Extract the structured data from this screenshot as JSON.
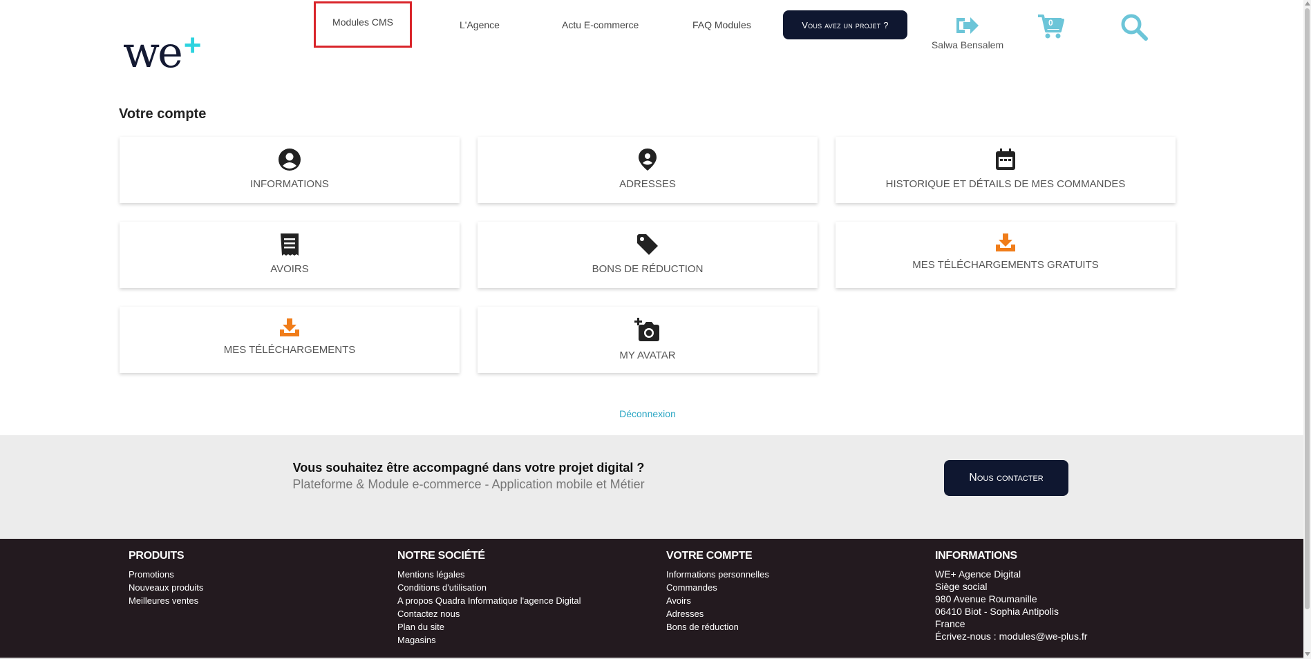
{
  "header": {
    "logo_text": "we",
    "logo_plus": "+",
    "nav": [
      {
        "label": "Modules CMS"
      },
      {
        "label": "L'Agence"
      },
      {
        "label": "Actu E-commerce"
      },
      {
        "label": "FAQ Modules"
      }
    ],
    "project_button": "Vous avez un projet ?",
    "user_name": "Salwa Bensalem",
    "cart_count": "0",
    "icons": {
      "logout": "sign-out-icon",
      "cart": "cart-icon",
      "search": "search-icon"
    },
    "accent_color": "#6cc5d8"
  },
  "account": {
    "title": "Votre compte",
    "cards": [
      {
        "label": "Informations",
        "icon": "user-circle-icon"
      },
      {
        "label": "Adresses",
        "icon": "location-pin-icon"
      },
      {
        "label": "Historique et détails de mes commandes",
        "icon": "calendar-icon"
      },
      {
        "label": "Avoirs",
        "icon": "receipt-icon"
      },
      {
        "label": "Bons de réduction",
        "icon": "tag-icon"
      },
      {
        "label": "Mes téléchargements gratuits",
        "icon": "download-icon"
      },
      {
        "label": "Mes téléchargements",
        "icon": "download-icon"
      },
      {
        "label": "My avatar",
        "icon": "add-photo-icon"
      }
    ],
    "logout_link": "Déconnexion"
  },
  "cta": {
    "title": "Vous souhaitez être accompagné dans votre projet digital ?",
    "subtitle": "Plateforme & Module e-commerce - Application mobile et Métier",
    "button": "Nous contacter"
  },
  "footer": {
    "products": {
      "title": "Produits",
      "items": [
        "Promotions",
        "Nouveaux produits",
        "Meilleures ventes"
      ]
    },
    "company": {
      "title": "Notre société",
      "items": [
        "Mentions légales",
        "Conditions d'utilisation",
        "A propos Quadra Informatique l'agence Digital",
        "Contactez nous",
        "Plan du site",
        "Magasins"
      ]
    },
    "account": {
      "title": "Votre compte",
      "items": [
        "Informations personnelles",
        "Commandes",
        "Avoirs",
        "Adresses",
        "Bons de réduction"
      ]
    },
    "info": {
      "title": "Informations",
      "items": [
        "WE+ Agence Digital",
        "Siège social",
        "980 Avenue Roumanille",
        "06410 Biot - Sophia Antipolis",
        "France",
        "Écrivez-nous : modules@we-plus.fr"
      ]
    }
  },
  "colors": {
    "dark_navy": "#0f1730",
    "footer_bg": "#231a1f",
    "orange": "#f07d1a",
    "active_outline": "#d9242a",
    "link": "#2aa6c3"
  }
}
